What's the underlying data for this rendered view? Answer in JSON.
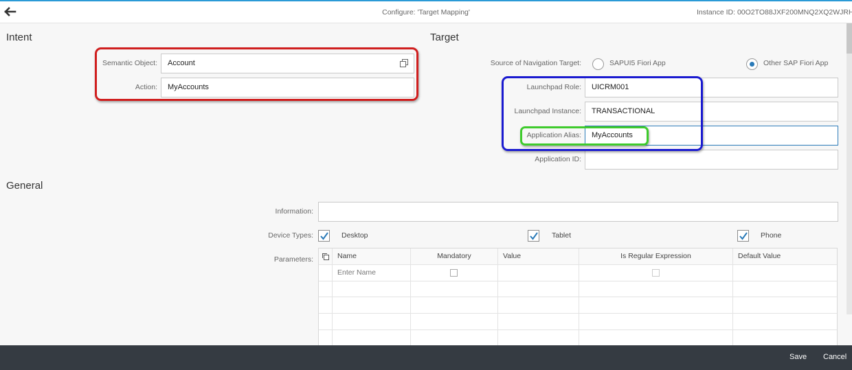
{
  "header": {
    "back_icon": "arrow-left-icon",
    "title": "Configure: 'Target Mapping'",
    "instance": "Instance ID: 00O2TO88JXF200MNQ2XQ2WJRH"
  },
  "intent": {
    "section_title": "Intent",
    "semantic_object_label": "Semantic Object:",
    "semantic_object_value": "Account",
    "value_help_icon": "value-help-icon",
    "action_label": "Action:",
    "action_value": "MyAccounts"
  },
  "target": {
    "section_title": "Target",
    "source_label": "Source of Navigation Target:",
    "source_options": [
      {
        "label": "SAPUI5 Fiori App",
        "selected": false
      },
      {
        "label": "Other SAP Fiori App",
        "selected": true
      }
    ],
    "launchpad_role_label": "Launchpad Role:",
    "launchpad_role_value": "UICRM001",
    "launchpad_instance_label": "Launchpad Instance:",
    "launchpad_instance_value": "TRANSACTIONAL",
    "application_alias_label": "Application Alias:",
    "application_alias_value": "MyAccounts",
    "application_id_label": "Application ID:",
    "application_id_value": ""
  },
  "general": {
    "section_title": "General",
    "information_label": "Information:",
    "information_value": "",
    "device_types_label": "Device Types:",
    "devices": [
      {
        "label": "Desktop",
        "checked": true
      },
      {
        "label": "Tablet",
        "checked": true
      },
      {
        "label": "Phone",
        "checked": true
      }
    ],
    "parameters_label": "Parameters:",
    "columns": [
      "Name",
      "Mandatory",
      "Value",
      "Is Regular Expression",
      "Default Value"
    ],
    "first_row_name_placeholder": "Enter Name"
  },
  "footer": {
    "save": "Save",
    "cancel": "Cancel"
  },
  "colors": {
    "accent": "#2a7ab8",
    "footer_bg": "#353b42",
    "highlight_red": "#d01e1e",
    "highlight_blue": "#1a1ad0",
    "highlight_green": "#3ecb2c"
  }
}
